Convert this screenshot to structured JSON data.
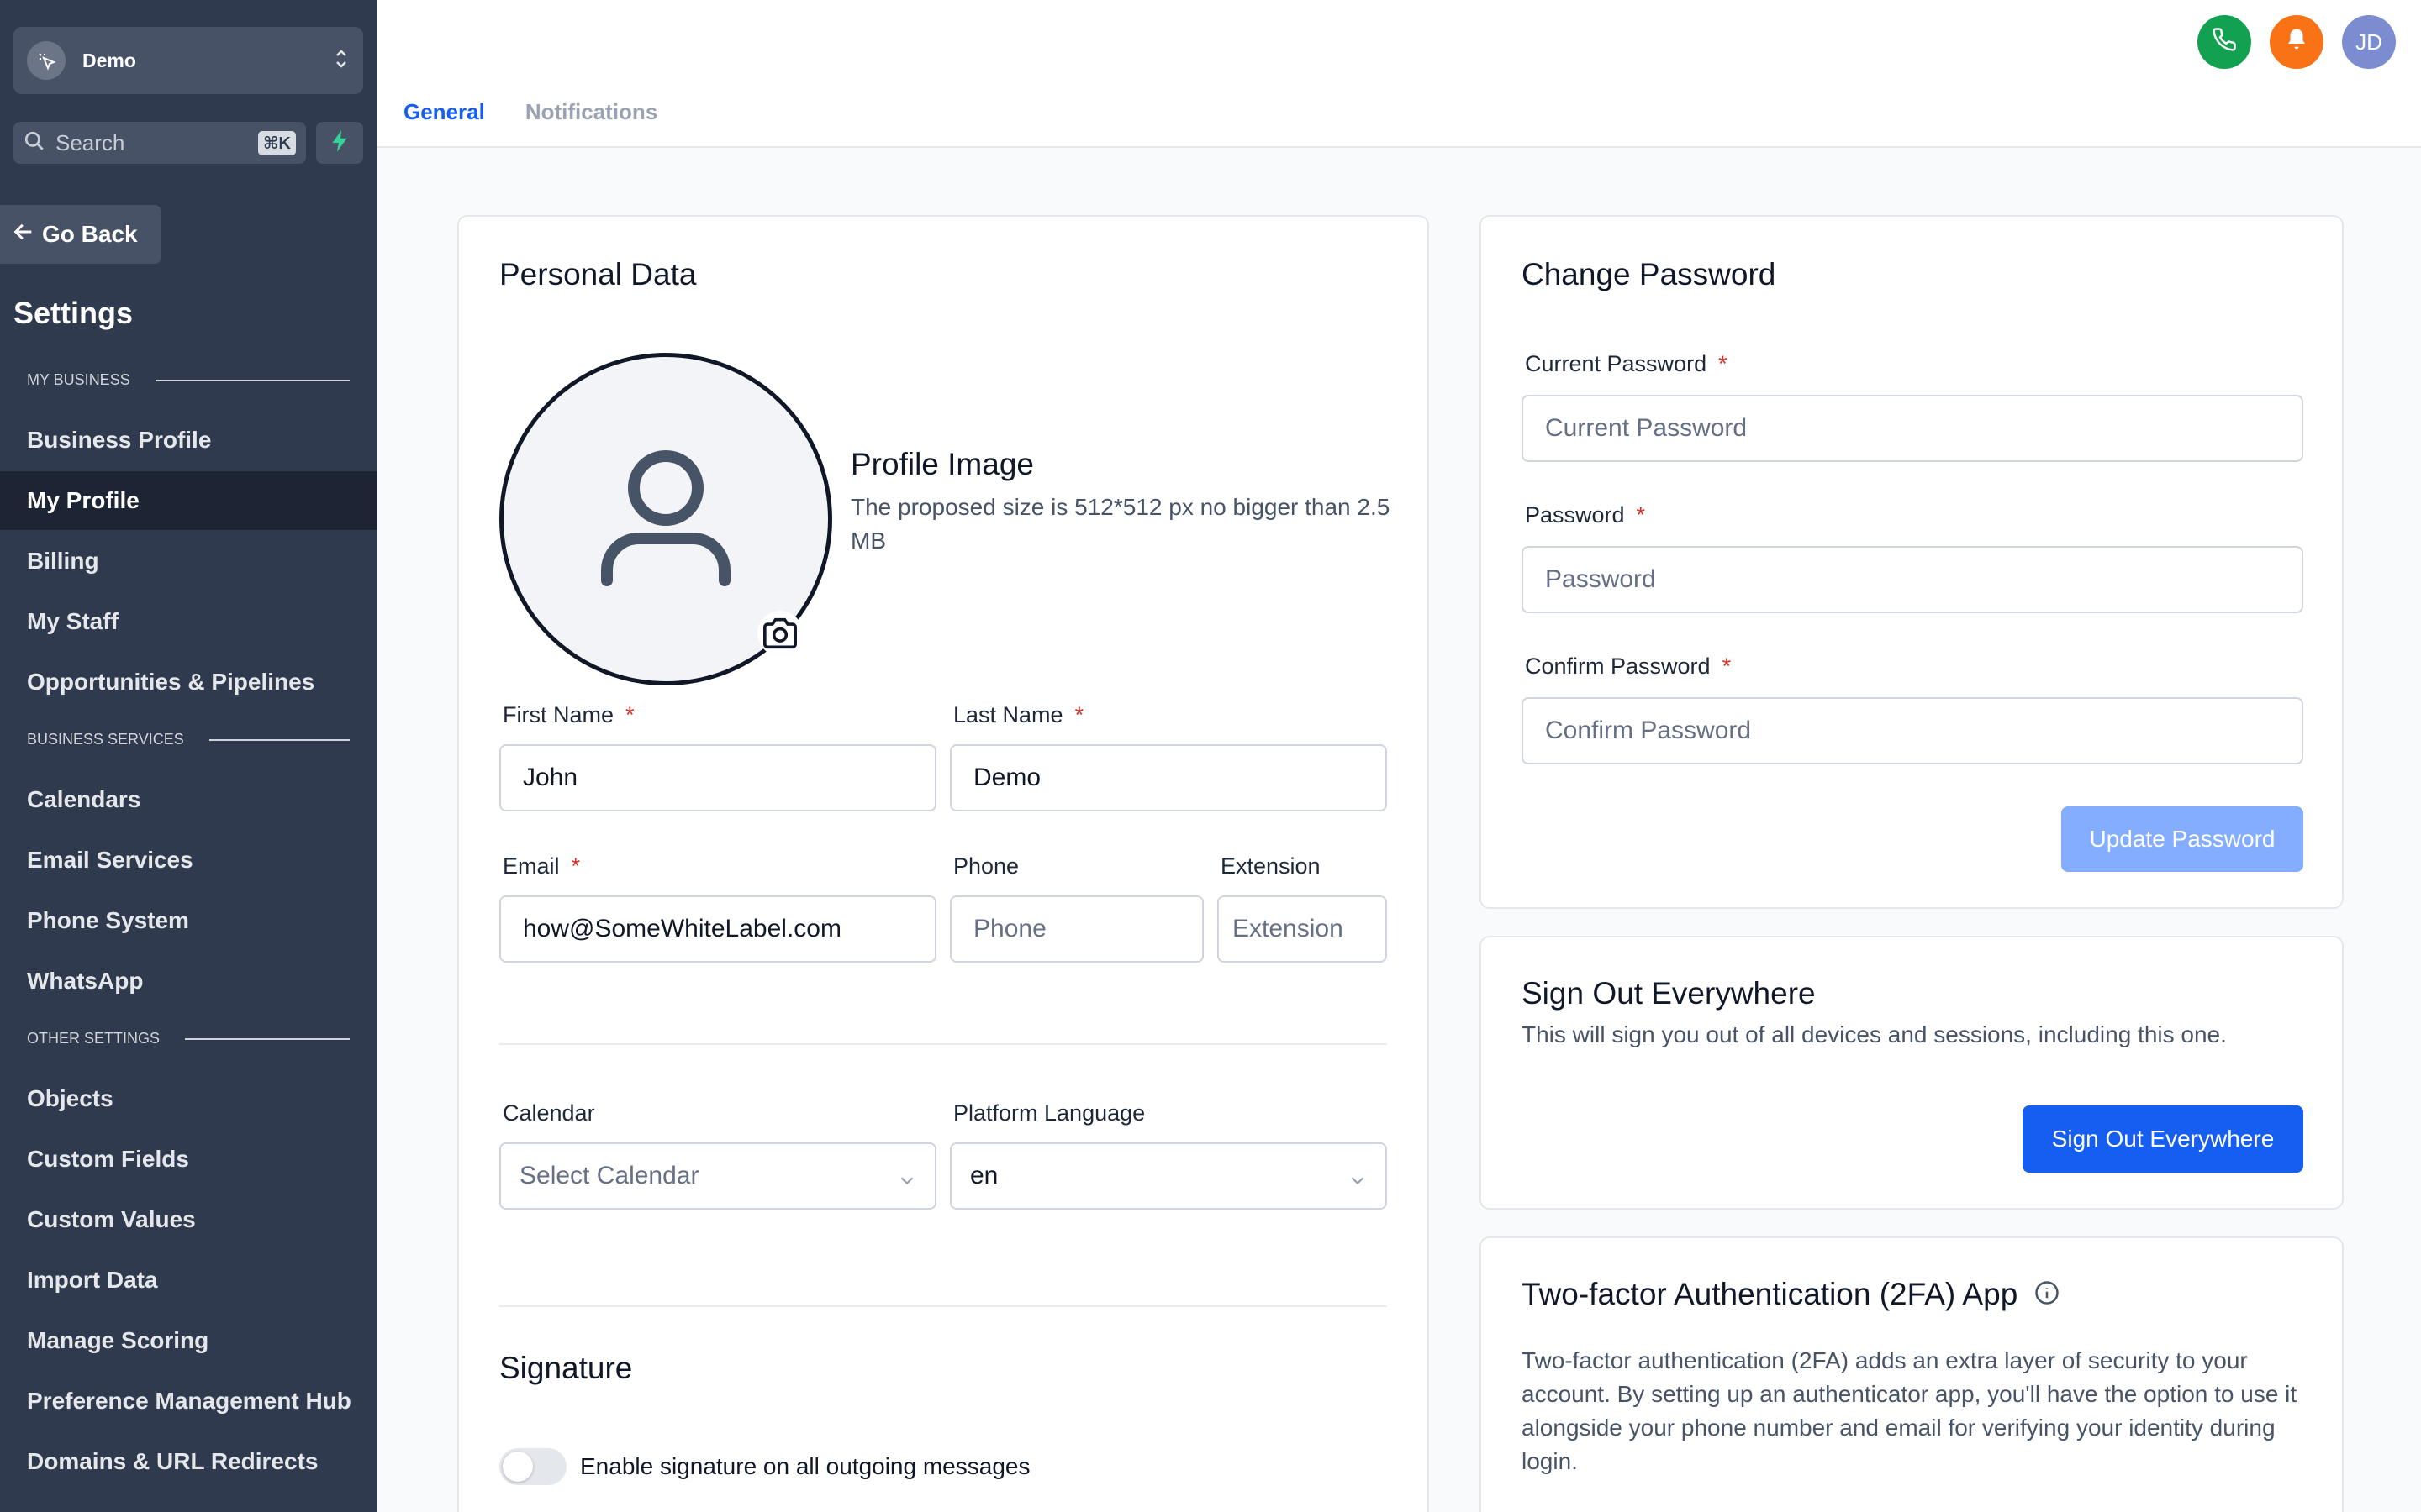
{
  "sidebar": {
    "account_name": "Demo",
    "search_placeholder": "Search",
    "search_shortcut": "⌘K",
    "go_back": "Go Back",
    "title": "Settings",
    "sections": [
      {
        "label": "MY BUSINESS"
      },
      {
        "label": "BUSINESS SERVICES"
      },
      {
        "label": "OTHER SETTINGS"
      }
    ],
    "items": [
      {
        "label": "Business Profile"
      },
      {
        "label": "My Profile"
      },
      {
        "label": "Billing"
      },
      {
        "label": "My Staff"
      },
      {
        "label": "Opportunities & Pipelines"
      },
      {
        "label": "Calendars"
      },
      {
        "label": "Email Services"
      },
      {
        "label": "Phone System"
      },
      {
        "label": "WhatsApp"
      },
      {
        "label": "Objects"
      },
      {
        "label": "Custom Fields"
      },
      {
        "label": "Custom Values"
      },
      {
        "label": "Import Data"
      },
      {
        "label": "Manage Scoring"
      },
      {
        "label": "Preference Management Hub"
      },
      {
        "label": "Domains & URL Redirects"
      }
    ],
    "active_item": "My Profile"
  },
  "header": {
    "avatar_initials": "JD",
    "tabs": [
      {
        "label": "General"
      },
      {
        "label": "Notifications"
      }
    ],
    "active_tab": "General",
    "colors": {
      "phone": "#12a150",
      "bell": "#f97316",
      "avatar": "#7c8cd1",
      "accent": "#155eef"
    }
  },
  "personal": {
    "title": "Personal Data",
    "profile_image_title": "Profile Image",
    "profile_image_hint": "The proposed size is 512*512 px no bigger than 2.5 MB",
    "first_name_label": "First Name",
    "first_name_value": "John",
    "last_name_label": "Last Name",
    "last_name_value": "Demo",
    "email_label": "Email",
    "email_value": "how@SomeWhiteLabel.com",
    "phone_label": "Phone",
    "phone_placeholder": "Phone",
    "extension_label": "Extension",
    "extension_placeholder": "Extension",
    "calendar_label": "Calendar",
    "calendar_placeholder": "Select Calendar",
    "language_label": "Platform Language",
    "language_value": "en",
    "signature_title": "Signature",
    "signature_toggle_label": "Enable signature on all outgoing messages",
    "required_mark": "*"
  },
  "password": {
    "title": "Change Password",
    "current_label": "Current Password",
    "current_placeholder": "Current Password",
    "new_label": "Password",
    "new_placeholder": "Password",
    "confirm_label": "Confirm Password",
    "confirm_placeholder": "Confirm Password",
    "update_button": "Update Password"
  },
  "signout": {
    "title": "Sign Out Everywhere",
    "description": "This will sign you out of all devices and sessions, including this one.",
    "button": "Sign Out Everywhere"
  },
  "twofa": {
    "title": "Two-factor Authentication (2FA) App",
    "description": "Two-factor authentication (2FA) adds an extra layer of security to your account. By setting up an authenticator app, you'll have the option to use it alongside your phone number and email for verifying your identity during login."
  }
}
